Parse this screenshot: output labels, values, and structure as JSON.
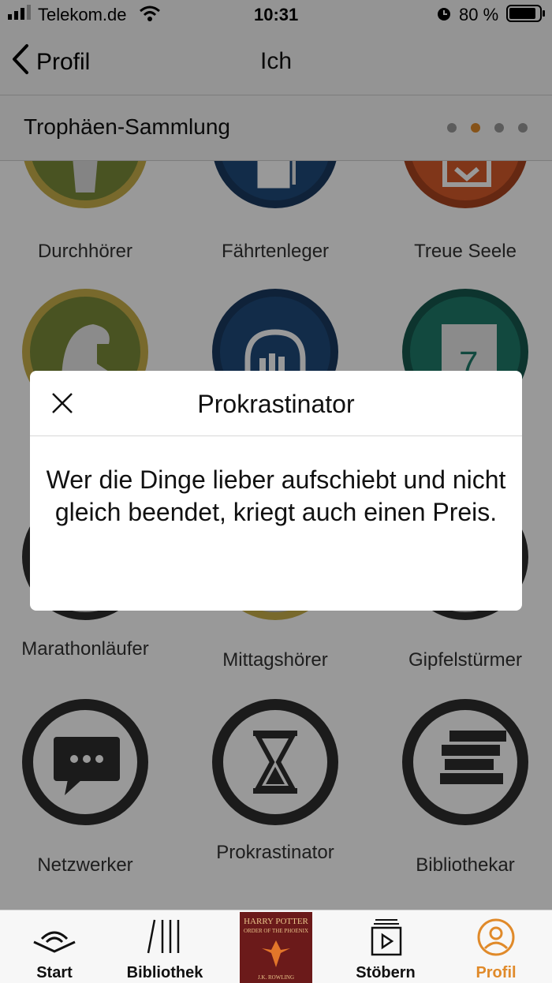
{
  "status_bar": {
    "carrier": "Telekom.de",
    "time": "10:31",
    "battery": "80 %"
  },
  "nav": {
    "back_label": "Profil",
    "title": "Ich"
  },
  "section": {
    "title": "Trophäen-Sammlung",
    "pages": 4,
    "active_page": 2
  },
  "trophies": [
    {
      "label": "Durchhörer",
      "icon": "cup-icon"
    },
    {
      "label": "Fährtenleger",
      "icon": "cards-icon"
    },
    {
      "label": "Treue Seele",
      "icon": "envelope-icon"
    },
    {
      "label": "",
      "icon": "spartan-helmet-icon"
    },
    {
      "label": "",
      "icon": "headphones-books-icon"
    },
    {
      "label": "",
      "icon": "calendar-icon"
    },
    {
      "label": "Marathonläufer",
      "icon": "runner-icon"
    },
    {
      "label": "Mittagshörer",
      "icon": "sun-icon"
    },
    {
      "label": "Gipfelstürmer",
      "icon": "mountain-icon"
    },
    {
      "label": "Netzwerker",
      "icon": "chat-bubble-icon"
    },
    {
      "label": "Prokrastinator",
      "icon": "hourglass-icon"
    },
    {
      "label": "Bibliothekar",
      "icon": "book-stack-icon"
    }
  ],
  "dialog": {
    "title": "Prokrastinator",
    "body": "Wer die Dinge lieber aufschiebt und nicht gleich beendet, kriegt auch einen Preis."
  },
  "tabbar": {
    "tabs": [
      {
        "label": "Start",
        "icon": "audible-icon"
      },
      {
        "label": "Bibliothek",
        "icon": "library-icon"
      },
      {
        "label": "",
        "icon": "now-playing-cover"
      },
      {
        "label": "Stöbern",
        "icon": "browse-icon"
      },
      {
        "label": "Profil",
        "icon": "profile-icon"
      }
    ],
    "active": "Profil",
    "cover": {
      "title": "HARRY POTTER",
      "subtitle": "ORDER OF THE PHOENIX",
      "author": "J.K. ROWLING"
    }
  },
  "colors": {
    "accent": "#e08a2a",
    "olive": "#7a8a3a",
    "navy": "#1f4a7a",
    "orange": "#d55a2a",
    "teal": "#1f7a6a",
    "locked": "#2e2e2e"
  }
}
